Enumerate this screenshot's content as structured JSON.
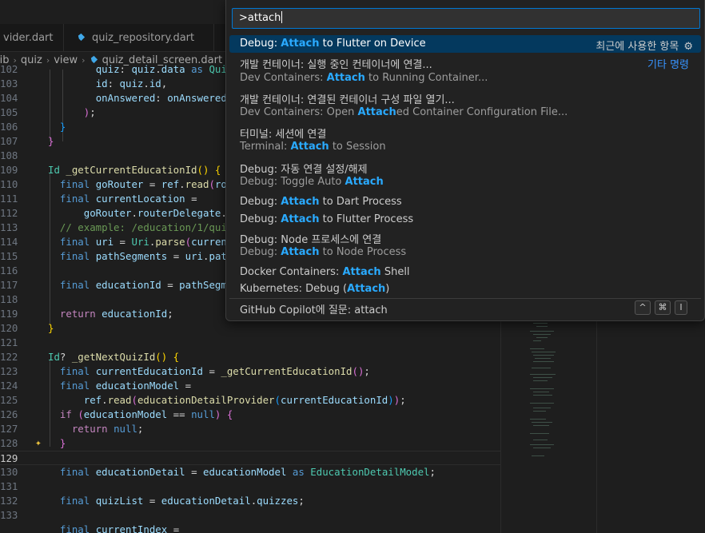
{
  "tabs": [
    {
      "label": "vider.dart"
    },
    {
      "label": "quiz_repository.dart"
    }
  ],
  "breadcrumb": [
    "lib",
    "quiz",
    "view",
    "quiz_detail_screen.dart"
  ],
  "palette": {
    "input": ">attach",
    "recent_label": "최근에 사용한 항목",
    "other_label": "기타 명령",
    "items": [
      {
        "pre": "Debug: ",
        "hl": "Attach",
        "post": " to Flutter on Device"
      },
      {
        "pre": "개발 컨테이너: 실행 중인 컨테이너에 연결...",
        "hl": "",
        "post": ""
      },
      {
        "pre": "Dev Containers: ",
        "hl": "Attach",
        "post": " to Running Container..."
      },
      {
        "pre": "개발 컨테이너: 연결된 컨테이너 구성 파일 열기...",
        "hl": "",
        "post": ""
      },
      {
        "pre": "Dev Containers: Open ",
        "hl": "Attach",
        "post": "ed Container Configuration File..."
      },
      {
        "pre": "터미널: 세션에 연결",
        "hl": "",
        "post": ""
      },
      {
        "pre": "Terminal: ",
        "hl": "Attach",
        "post": " to Session"
      },
      {
        "pre": "Debug: 자동 연결 설정/해제",
        "hl": "",
        "post": ""
      },
      {
        "pre": "Debug: Toggle Auto ",
        "hl": "Attach",
        "post": ""
      },
      {
        "pre": "Debug: ",
        "hl": "Attach",
        "post": " to Dart Process"
      },
      {
        "pre": "Debug: ",
        "hl": "Attach",
        "post": " to Flutter Process"
      },
      {
        "pre": "Debug: Node 프로세스에 연결",
        "hl": "",
        "post": ""
      },
      {
        "pre": "Debug: ",
        "hl": "Attach",
        "post": " to Node Process"
      },
      {
        "pre": "Docker Containers: ",
        "hl": "Attach",
        "post": " Shell"
      },
      {
        "pre": "Kubernetes: Debug (",
        "hl": "Attach",
        "post": ")"
      },
      {
        "pre": "GitHub Copilot에 질문: attach",
        "hl": "",
        "post": ""
      }
    ],
    "kbd": [
      "^",
      "⌘",
      "I"
    ]
  },
  "code": {
    "line_numbers": [
      "102",
      "103",
      "104",
      "105",
      "106",
      "107",
      "108",
      "109",
      "110",
      "111",
      "112",
      "113",
      "114",
      "115",
      "116",
      "117",
      "118",
      "119",
      "120",
      "121",
      "122",
      "123",
      "124",
      "125",
      "126",
      "127",
      "128",
      "129",
      "130",
      "131",
      "132",
      "133"
    ]
  }
}
